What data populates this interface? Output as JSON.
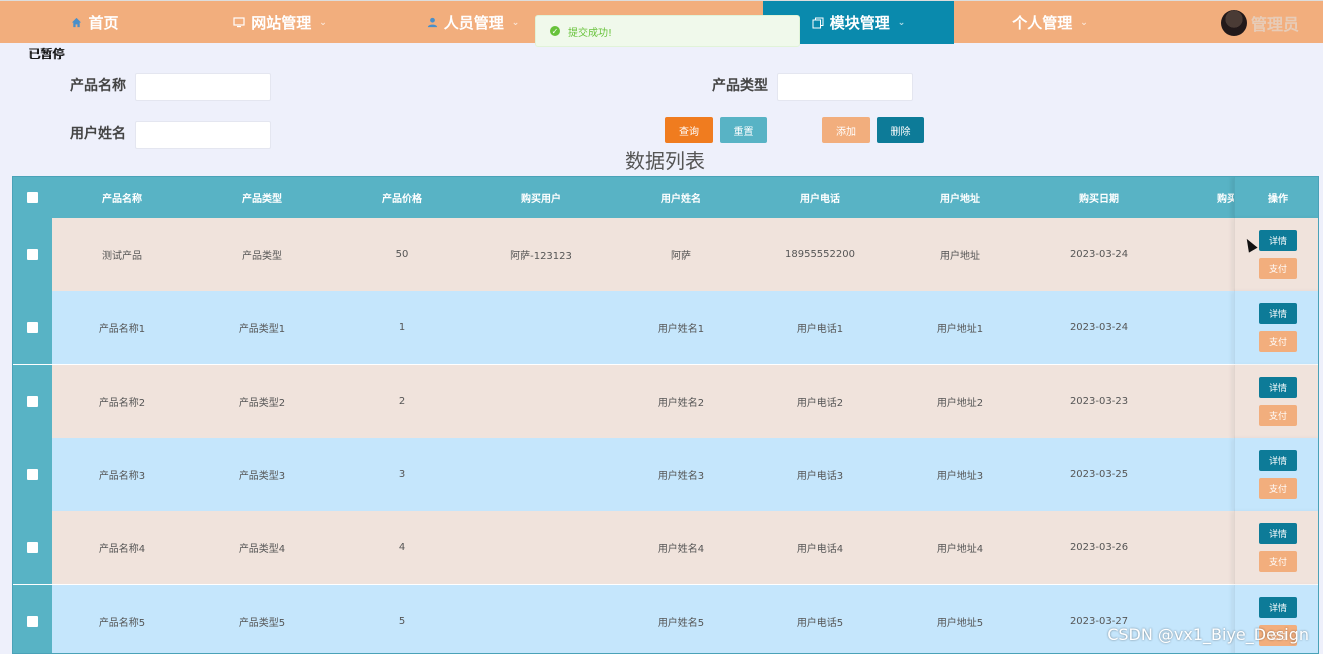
{
  "nav": {
    "items": [
      {
        "label": "首页",
        "icon": "home-icon",
        "has_dropdown": false,
        "active": false
      },
      {
        "label": "网站管理",
        "icon": "monitor-icon",
        "has_dropdown": true,
        "active": false
      },
      {
        "label": "人员管理",
        "icon": "user-icon",
        "has_dropdown": true,
        "active": false
      },
      {
        "label": "模块管理",
        "icon": "copy-icon",
        "has_dropdown": true,
        "active": true
      },
      {
        "label": "个人管理",
        "icon": "",
        "has_dropdown": true,
        "active": false
      }
    ],
    "admin_name": "管理员"
  },
  "toast": {
    "message": "提交成功!"
  },
  "paused_text": "已暂停",
  "search": {
    "product_name_label": "产品名称",
    "product_name_value": "",
    "product_type_label": "产品类型",
    "product_type_value": "",
    "user_name_label": "用户姓名",
    "user_name_value": "",
    "buttons": {
      "query": "查询",
      "reset": "重置",
      "add": "添加",
      "delete": "删除"
    }
  },
  "list_title": "数据列表",
  "table": {
    "headers": [
      "产品名称",
      "产品类型",
      "产品价格",
      "购买用户",
      "用户姓名",
      "用户电话",
      "用户地址",
      "购买日期",
      "购买",
      "操作"
    ],
    "rows": [
      [
        "测试产品",
        "产品类型",
        "50",
        "阿萨-123123",
        "阿萨",
        "18955552200",
        "用户地址",
        "2023-03-24"
      ],
      [
        "产品名称1",
        "产品类型1",
        "1",
        "",
        "用户姓名1",
        "用户电话1",
        "用户地址1",
        "2023-03-24"
      ],
      [
        "产品名称2",
        "产品类型2",
        "2",
        "",
        "用户姓名2",
        "用户电话2",
        "用户地址2",
        "2023-03-23"
      ],
      [
        "产品名称3",
        "产品类型3",
        "3",
        "",
        "用户姓名3",
        "用户电话3",
        "用户地址3",
        "2023-03-25"
      ],
      [
        "产品名称4",
        "产品类型4",
        "4",
        "",
        "用户姓名4",
        "用户电话4",
        "用户地址4",
        "2023-03-26"
      ],
      [
        "产品名称5",
        "产品类型5",
        "5",
        "",
        "用户姓名5",
        "用户电话5",
        "用户地址5",
        "2023-03-27"
      ]
    ],
    "detail_label": "详情",
    "pay_label": "支付"
  },
  "colors": {
    "nav": "#f2ae7d",
    "nav_active": "#0a8aad",
    "header": "#58b3c5",
    "row_odd": "#f0e3dc",
    "row_even": "#c5e6fc",
    "query_btn": "#f07c1f",
    "reset_btn": "#58b3c5",
    "add_btn": "#f2ae7d",
    "delete_btn": "#0d7b98"
  },
  "watermark": "CSDN @vx1_Biye_Design"
}
